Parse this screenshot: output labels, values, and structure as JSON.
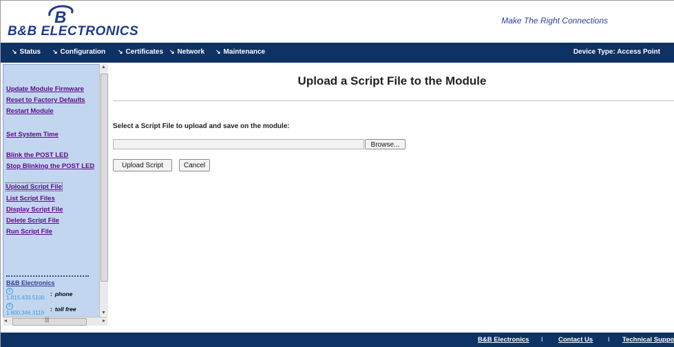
{
  "header": {
    "logo_mark": "B",
    "logo_text": "B&B ELECTRONICS",
    "tagline": "Make The Right Connections"
  },
  "nav": {
    "items": [
      {
        "label": "Status"
      },
      {
        "label": "Configuration"
      },
      {
        "label": "Certificates"
      },
      {
        "label": "Network"
      },
      {
        "label": "Maintenance"
      }
    ],
    "arrow": "↘",
    "device_type": "Device Type: Access Point"
  },
  "sidebar": {
    "links": [
      {
        "label": "Update Module Firmware"
      },
      {
        "label": "Reset to Factory Defaults"
      },
      {
        "label": "Restart Module"
      },
      {
        "label": "Set System Time"
      },
      {
        "label": "Blink the POST LED"
      },
      {
        "label": "Stop Blinking the POST LED"
      },
      {
        "label": "Upload Script File",
        "selected": true
      },
      {
        "label": "List Script Files"
      },
      {
        "label": "Display Script File"
      },
      {
        "label": "Delete Script File"
      },
      {
        "label": "Run Script File"
      }
    ],
    "company": "B&B Electronics",
    "contacts": [
      {
        "number": "1.815.433.5100",
        "sep": ":",
        "label": "phone",
        "icon": "phone-icon"
      },
      {
        "number": "1.800.346.3119",
        "sep": ":",
        "label": "toll free",
        "icon": "phone-icon"
      }
    ]
  },
  "main": {
    "title": "Upload a Script File to the Module",
    "instruction": "Select a Script File to upload and save on the module:",
    "file_input_value": "",
    "browse_label": "Browse...",
    "upload_label": "Upload Script",
    "cancel_label": "Cancel"
  },
  "footer": {
    "links": [
      {
        "label": "B&B Electronics"
      },
      {
        "label": "Contact Us"
      },
      {
        "label": "Technical Support"
      }
    ],
    "separator": "I"
  },
  "colors": {
    "navbar": "#0e3263",
    "sidebar_bg": "#c3d6ef",
    "link": "#5a0a8a",
    "brand_blue": "#1f3b8c"
  }
}
